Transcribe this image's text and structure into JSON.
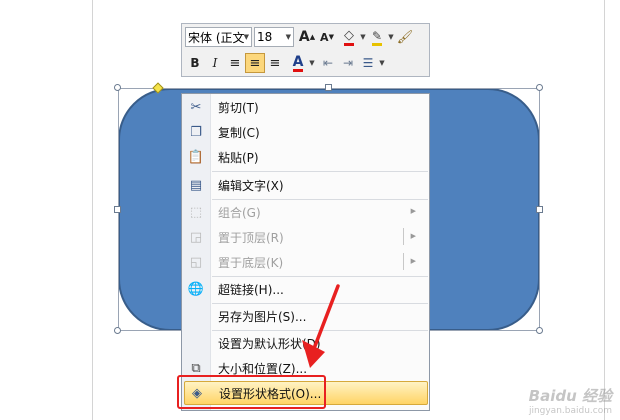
{
  "mini_toolbar": {
    "font_name": "宋体 (正文",
    "font_size": "18",
    "grow_font": "A",
    "shrink_font": "A",
    "bold": "B",
    "italic": "I",
    "font_color": "A"
  },
  "context_menu": {
    "items": [
      {
        "label": "剪切(T)",
        "icon": "scissors-icon",
        "enabled": true
      },
      {
        "label": "复制(C)",
        "icon": "copy-icon",
        "enabled": true
      },
      {
        "label": "粘贴(P)",
        "icon": "paste-icon",
        "enabled": true
      },
      {
        "label": "编辑文字(X)",
        "icon": "edit-text-icon",
        "enabled": true
      },
      {
        "label": "组合(G)",
        "icon": "group-icon",
        "enabled": false,
        "submenu": true
      },
      {
        "label": "置于顶层(R)",
        "icon": "bring-front-icon",
        "enabled": false,
        "submenu": true
      },
      {
        "label": "置于底层(K)",
        "icon": "send-back-icon",
        "enabled": false,
        "submenu": true
      },
      {
        "label": "超链接(H)...",
        "icon": "hyperlink-icon",
        "enabled": true
      },
      {
        "label": "另存为图片(S)...",
        "icon": "",
        "enabled": true
      },
      {
        "label": "设置为默认形状(D)",
        "icon": "",
        "enabled": true
      },
      {
        "label": "大小和位置(Z)...",
        "icon": "size-position-icon",
        "enabled": true
      },
      {
        "label": "设置形状格式(O)...",
        "icon": "format-shape-icon",
        "enabled": true,
        "highlighted": true
      }
    ]
  },
  "watermark": {
    "text": "Baidu 经验",
    "sub": "jingyan.baidu.com"
  },
  "colors": {
    "shape_fill": "#4f81bd",
    "highlight": "#ffd466",
    "callout": "#e82020"
  }
}
